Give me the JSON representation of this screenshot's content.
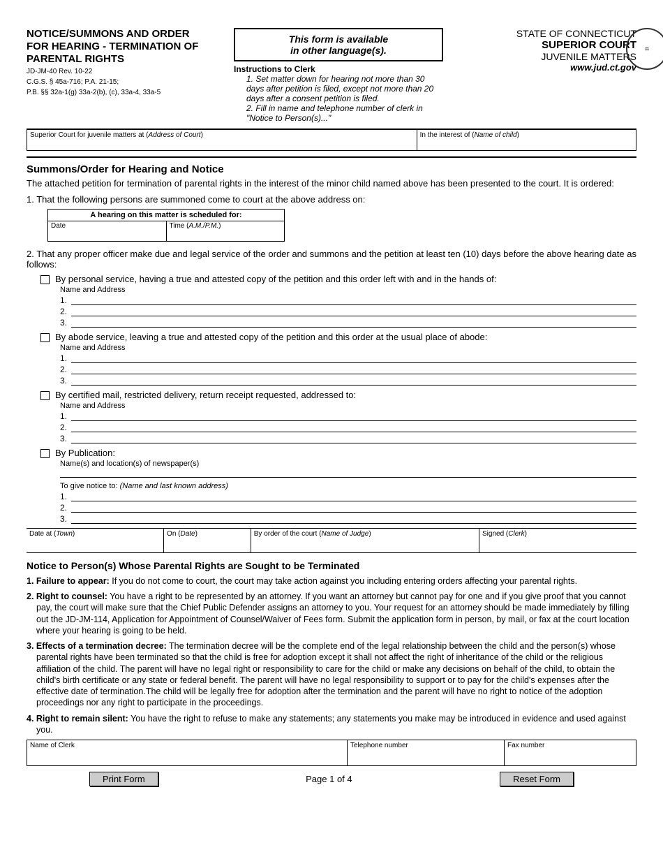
{
  "header": {
    "title": "NOTICE/SUMMONS AND ORDER FOR HEARING - TERMINATION OF PARENTAL RIGHTS",
    "form_id": "JD-JM-40   Rev. 10-22",
    "cgs": "C.G.S. § 45a-716; P.A. 21-15;",
    "pb": "P.B. §§ 32a-1(g) 33a-2(b), (c), 33a-4, 33a-5",
    "lang_box_l1": "This form is available",
    "lang_box_l2": "in other language(s).",
    "instr_title": "Instructions to Clerk",
    "instr_1": "1. Set matter down for hearing not more than 30 days after petition is filed, except not more than 20 days after a consent petition is filed.",
    "instr_2": "2. Fill in name and telephone number of clerk in \"Notice to Person(s)...\"",
    "state": "STATE OF CONNECTICUT",
    "court": "SUPERIOR COURT",
    "juvenile": "JUVENILE MATTERS",
    "url": "www.jud.ct.gov",
    "seal_text": "CT JUDICIAL BRANCH"
  },
  "court_row": {
    "left_label": "Superior Court for juvenile matters at (",
    "left_italic": "Address of Court",
    "left_close": ")",
    "right_label": "In the interest of (",
    "right_italic": "Name of child",
    "right_close": ")"
  },
  "summons": {
    "title": "Summons/Order for Hearing and Notice",
    "intro": "The attached petition for termination of parental rights in the interest of the minor child named above has been presented to the court. It is ordered:",
    "item1": "1. That the following persons are summoned come to court at the above address on:",
    "sched_header": "A hearing on this matter is scheduled for:",
    "date_label": "Date",
    "time_label": "Time (",
    "time_italic": "A.M./P.M.",
    "time_close": ")",
    "item2": "2. That any proper officer make due and legal service of the order and summons and the petition at least ten (10) days before the above hearing date as follows:",
    "cb_personal": "By personal service, having a true and attested copy of the petition and this order left with and in the hands of:",
    "cb_abode": "By abode service, leaving a true and attested copy of the petition and this order at the usual place of abode:",
    "cb_mail": "By certified mail, restricted delivery, return receipt requested, addressed to:",
    "cb_pub": "By Publication:",
    "name_addr": "Name and Address",
    "pub_sub": "Name(s) and location(s) of newspaper(s)",
    "notice_to": "To give notice to: ",
    "notice_to_italic": "(Name and last known address)",
    "line_nums": [
      "1.",
      "2.",
      "3."
    ]
  },
  "sig": {
    "c1": "Date at (",
    "c1_italic": "Town",
    "c1_close": ")",
    "c2": "On (",
    "c2_italic": "Date",
    "c2_close": ")",
    "c3": "By order of the court (",
    "c3_italic": "Name of Judge",
    "c3_close": ")",
    "c4": "Signed (",
    "c4_italic": "Clerk",
    "c4_close": ")"
  },
  "notice": {
    "title": "Notice to Person(s) Whose Parental Rights are Sought to be Terminated",
    "n1_bold": "1. Failure to appear:",
    "n1": " If you do not come to court, the court may take action against you including entering orders affecting your parental rights.",
    "n2_bold": "2. Right to counsel:",
    "n2": " You have a right to be represented by an attorney. If you want an attorney but cannot pay for one and if you give proof that you cannot pay, the court will make sure that the Chief Public Defender assigns an attorney to you. Your request for an attorney should be made immediately by filling out the JD-JM-114, Application for Appointment of Counsel/Waiver of Fees form. Submit the application form in person, by mail, or fax at the court location where your hearing is going to be held.",
    "n3_bold": "3. Effects of a termination decree:",
    "n3": " The termination decree will be the complete end of the legal relationship between the child and the person(s) whose parental rights have been terminated so that the child is free for adoption except it shall not affect the right of inheritance of the child or the religious affiliation of the child. The parent will have no legal right or responsibility to care for the child or make any decisions on behalf of the child, to obtain the child's birth certificate or any state or federal benefit. The parent will have no legal responsibility to support or to pay for the child's expenses after the effective date of termination.The child will be legally free for adoption after the termination and the parent will have no right to notice of the adoption proceedings nor any right to participate in the proceedings.",
    "n4_bold": "4. Right to remain silent:",
    "n4": " You have the right to refuse to make any statements; any statements you make may be introduced in evidence and used against you."
  },
  "clerk": {
    "name": "Name of Clerk",
    "tel": "Telephone number",
    "fax": "Fax number"
  },
  "footer": {
    "print": "Print Form",
    "page": "Page 1 of 4",
    "reset": "Reset Form"
  }
}
